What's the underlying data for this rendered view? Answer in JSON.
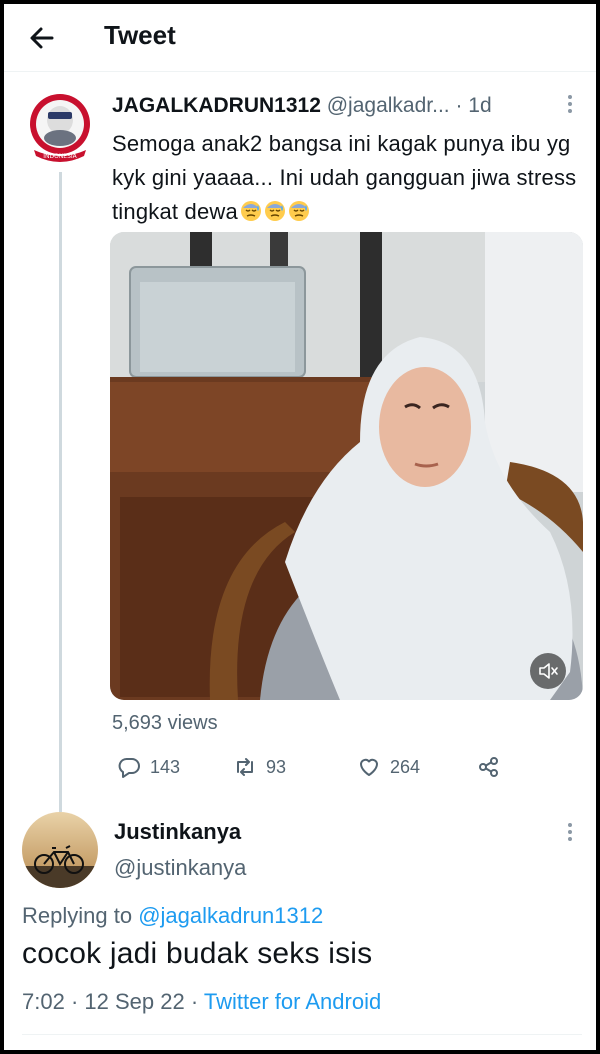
{
  "header": {
    "title": "Tweet"
  },
  "tweet": {
    "name": "JAGALKADRUN1312",
    "handle": "@jagalkadr...",
    "time": "1d",
    "text": "Semoga anak2 bangsa ini kagak punya ibu yg kyk gini yaaaa... Ini udah gangguan jiwa stress tingkat dewa",
    "emoji": [
      "downcast-sweat-face",
      "downcast-sweat-face",
      "downcast-sweat-face"
    ],
    "avatar_caption": "INDONESIA",
    "views": "5,693 views",
    "actions": {
      "replies": "143",
      "retweets": "93",
      "likes": "264"
    }
  },
  "reply": {
    "name": "Justinkanya",
    "handle": "@justinkanya",
    "replying_prefix": "Replying to",
    "replying_to": "@jagalkadrun1312",
    "text": "cocok jadi budak seks isis",
    "time": "7:02",
    "date": "12 Sep 22",
    "source": "Twitter for Android"
  },
  "colors": {
    "link": "#1d9bf0",
    "secondary": "#536471",
    "divider": "#eff3f4",
    "avatar_red": "#c8102e"
  }
}
